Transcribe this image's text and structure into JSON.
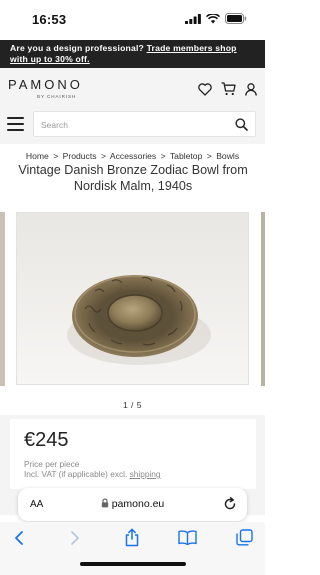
{
  "status_bar": {
    "time": "16:53"
  },
  "promo": {
    "text": "Are you a design professional?",
    "link_text": "Trade members shop with up to 30% off."
  },
  "header": {
    "logo": "PAMONO",
    "logo_sub": "BY CHAIRISH",
    "icons": [
      "heart-icon",
      "cart-icon",
      "user-icon"
    ]
  },
  "search": {
    "placeholder": "Search"
  },
  "breadcrumb": {
    "items": [
      "Home",
      "Products",
      "Accessories",
      "Tabletop",
      "Bowls"
    ],
    "separator": ">"
  },
  "product": {
    "title": "Vintage Danish Bronze Zodiac Bowl from Nordisk Malm, 1940s",
    "image_counter": "1 / 5",
    "price": "€245",
    "price_unit": "Price per piece",
    "vat_note": "Incl. VAT (if applicable) excl.",
    "shipping_link": "shipping"
  },
  "browser": {
    "aa_label": "AA",
    "url": "pamono.eu"
  },
  "colors": {
    "banner_bg": "#222222",
    "header_bg": "#f4f4f4",
    "ios_blue": "#1a73e8",
    "bronze": "#8b7a5a"
  }
}
